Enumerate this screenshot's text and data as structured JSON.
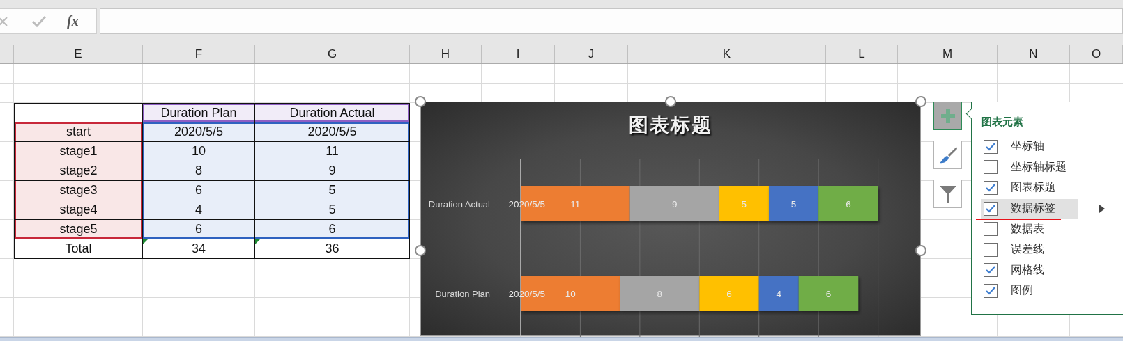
{
  "formula_bar": {
    "function_label": "fx"
  },
  "column_headers": [
    "E",
    "F",
    "G",
    "H",
    "I",
    "J",
    "K",
    "L",
    "M",
    "N",
    "O"
  ],
  "table": {
    "rows": [
      {
        "kind": "header",
        "cells": [
          {
            "text": "",
            "flagged": false
          },
          {
            "text": "Duration Plan",
            "flagged": false
          },
          {
            "text": "Duration Actual",
            "flagged": false
          }
        ]
      },
      {
        "kind": "data",
        "cells": [
          {
            "text": "start",
            "flagged": false
          },
          {
            "text": "2020/5/5",
            "flagged": false
          },
          {
            "text": "2020/5/5",
            "flagged": false
          }
        ]
      },
      {
        "kind": "data",
        "cells": [
          {
            "text": "stage1",
            "flagged": false
          },
          {
            "text": "10",
            "flagged": false
          },
          {
            "text": "11",
            "flagged": false
          }
        ]
      },
      {
        "kind": "data",
        "cells": [
          {
            "text": "stage2",
            "flagged": false
          },
          {
            "text": "8",
            "flagged": false
          },
          {
            "text": "9",
            "flagged": false
          }
        ]
      },
      {
        "kind": "data",
        "cells": [
          {
            "text": "stage3",
            "flagged": false
          },
          {
            "text": "6",
            "flagged": false
          },
          {
            "text": "5",
            "flagged": false
          }
        ]
      },
      {
        "kind": "data",
        "cells": [
          {
            "text": "stage4",
            "flagged": false
          },
          {
            "text": "4",
            "flagged": false
          },
          {
            "text": "5",
            "flagged": false
          }
        ]
      },
      {
        "kind": "data",
        "cells": [
          {
            "text": "stage5",
            "flagged": false
          },
          {
            "text": "6",
            "flagged": false
          },
          {
            "text": "6",
            "flagged": false
          }
        ]
      },
      {
        "kind": "total",
        "cells": [
          {
            "text": "Total",
            "flagged": false
          },
          {
            "text": "34",
            "flagged": true
          },
          {
            "text": "36",
            "flagged": true
          }
        ]
      }
    ]
  },
  "chart": {
    "start_labels": [
      "2020/5/5",
      "2020/5/5"
    ],
    "chart_data": {
      "type": "bar",
      "orientation": "horizontal",
      "stacked": true,
      "title": "图表标题",
      "categories": [
        "Duration Actual",
        "Duration Plan"
      ],
      "series": [
        {
          "color": "#ed7d31",
          "values": [
            11,
            10
          ]
        },
        {
          "color": "#a5a5a5",
          "values": [
            9,
            8
          ]
        },
        {
          "color": "#ffc000",
          "values": [
            5,
            6
          ]
        },
        {
          "color": "#4472c4",
          "values": [
            5,
            4
          ]
        },
        {
          "color": "#70ad47",
          "values": [
            6,
            6
          ]
        }
      ],
      "xlim": [
        0,
        36
      ],
      "data_labels": true
    }
  },
  "side_buttons": [
    {
      "kind": "add",
      "selected": true
    },
    {
      "kind": "style",
      "selected": false
    },
    {
      "kind": "filter",
      "selected": false
    }
  ],
  "elements_panel": {
    "title": "图表元素",
    "items": [
      {
        "label": "坐标轴",
        "checked": true,
        "selected": false,
        "underlined": false
      },
      {
        "label": "坐标轴标题",
        "checked": false,
        "selected": false,
        "underlined": false
      },
      {
        "label": "图表标题",
        "checked": true,
        "selected": false,
        "underlined": false
      },
      {
        "label": "数据标签",
        "checked": true,
        "selected": true,
        "underlined": true
      },
      {
        "label": "数据表",
        "checked": false,
        "selected": false,
        "underlined": false
      },
      {
        "label": "误差线",
        "checked": false,
        "selected": false,
        "underlined": false
      },
      {
        "label": "网格线",
        "checked": true,
        "selected": false,
        "underlined": false
      },
      {
        "label": "图例",
        "checked": true,
        "selected": false,
        "underlined": false
      }
    ]
  }
}
